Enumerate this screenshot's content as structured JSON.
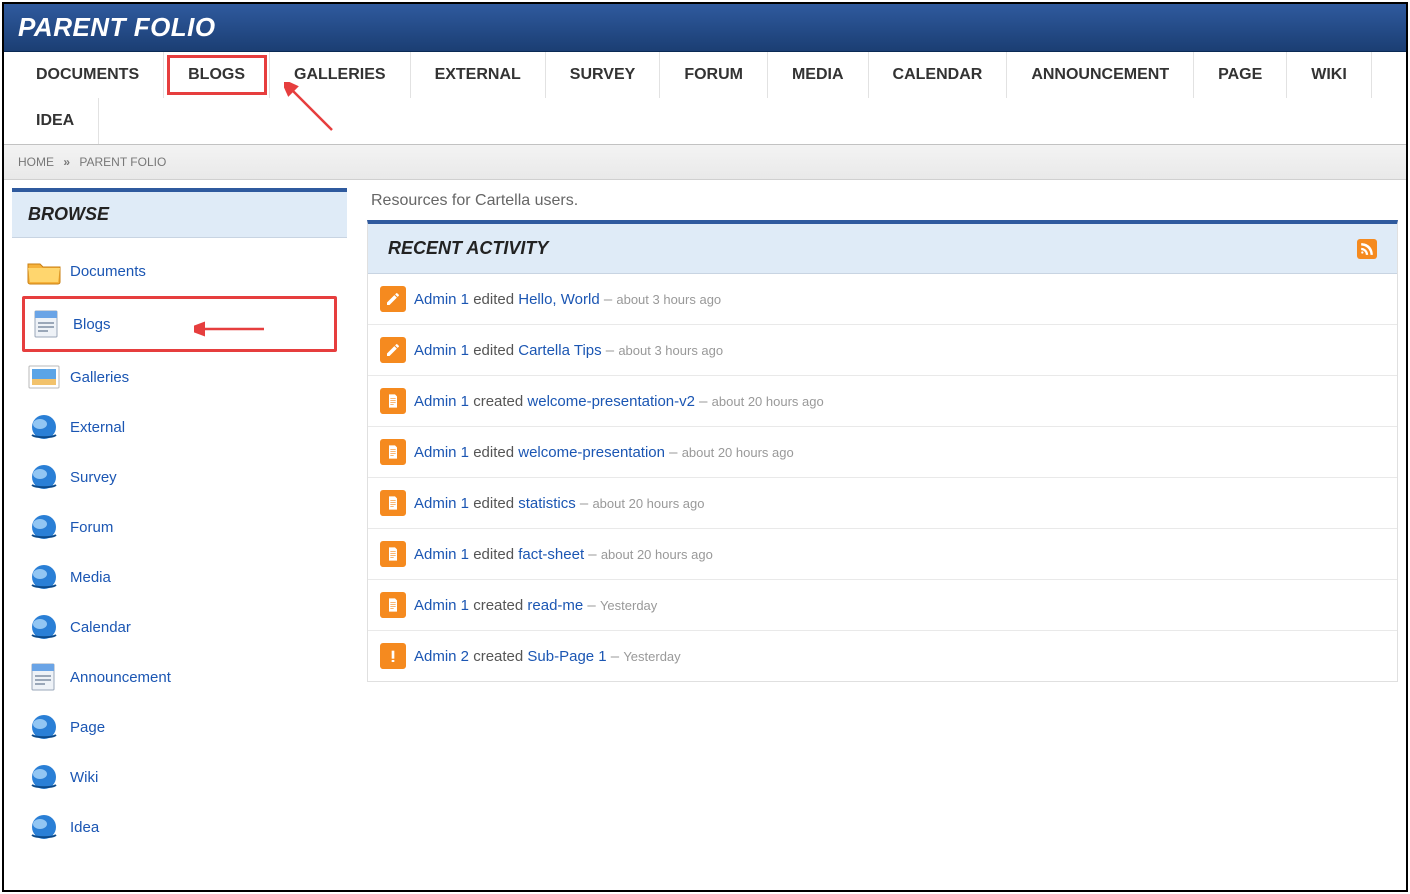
{
  "header": {
    "title": "PARENT FOLIO"
  },
  "nav": {
    "tabs": [
      "DOCUMENTS",
      "BLOGS",
      "GALLERIES",
      "EXTERNAL",
      "SURVEY",
      "FORUM",
      "MEDIA",
      "CALENDAR",
      "ANNOUNCEMENT",
      "PAGE",
      "WIKI",
      "IDEA"
    ]
  },
  "breadcrumb": {
    "home": "HOME",
    "sep": "»",
    "current": "PARENT FOLIO"
  },
  "sidebar": {
    "title": "BROWSE",
    "items": [
      {
        "label": "Documents",
        "icon": "folder"
      },
      {
        "label": "Blogs",
        "icon": "page"
      },
      {
        "label": "Galleries",
        "icon": "picture"
      },
      {
        "label": "External",
        "icon": "globe"
      },
      {
        "label": "Survey",
        "icon": "globe"
      },
      {
        "label": "Forum",
        "icon": "globe"
      },
      {
        "label": "Media",
        "icon": "globe"
      },
      {
        "label": "Calendar",
        "icon": "globe"
      },
      {
        "label": "Announcement",
        "icon": "page"
      },
      {
        "label": "Page",
        "icon": "globe"
      },
      {
        "label": "Wiki",
        "icon": "globe"
      },
      {
        "label": "Idea",
        "icon": "globe"
      }
    ]
  },
  "main": {
    "intro": "Resources for Cartella users.",
    "panel_title": "RECENT ACTIVITY",
    "activities": [
      {
        "user": "Admin 1",
        "action": "edited",
        "target": "Hello, World",
        "time": "about 3 hours ago",
        "icon": "edit"
      },
      {
        "user": "Admin 1",
        "action": "edited",
        "target": "Cartella Tips",
        "time": "about 3 hours ago",
        "icon": "edit"
      },
      {
        "user": "Admin 1",
        "action": "created",
        "target": "welcome-presentation-v2",
        "time": "about 20 hours ago",
        "icon": "doc"
      },
      {
        "user": "Admin 1",
        "action": "edited",
        "target": "welcome-presentation",
        "time": "about 20 hours ago",
        "icon": "doc"
      },
      {
        "user": "Admin 1",
        "action": "edited",
        "target": "statistics",
        "time": "about 20 hours ago",
        "icon": "doc"
      },
      {
        "user": "Admin 1",
        "action": "edited",
        "target": "fact-sheet",
        "time": "about 20 hours ago",
        "icon": "doc"
      },
      {
        "user": "Admin 1",
        "action": "created",
        "target": "read-me",
        "time": "Yesterday",
        "icon": "doc"
      },
      {
        "user": "Admin 2",
        "action": "created",
        "target": "Sub-Page 1",
        "time": "Yesterday",
        "icon": "alert"
      }
    ]
  },
  "annotations": {
    "blogs_tab_highlighted": true,
    "blogs_sidebar_highlighted": true
  }
}
